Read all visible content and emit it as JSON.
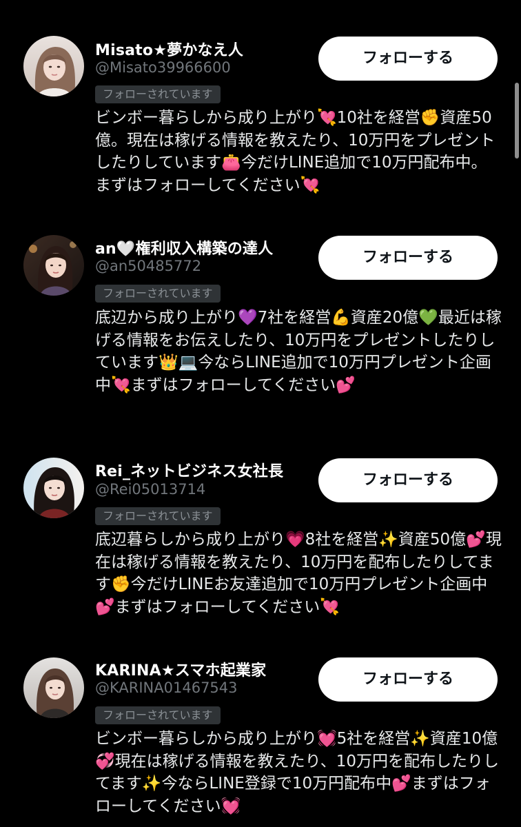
{
  "users": [
    {
      "display_name": "Misato★夢かなえ人",
      "handle": "@Misato39966600",
      "follows_you_label": "フォローされています",
      "follow_button_label": "フォローする",
      "bio": "ビンボー暮らしから成り上がり💘10社を経営✊資産50億。現在は稼げる情報を教えたり、10万円をプレゼントしたりしています👛今だけLINE追加で10万円配布中。まずはフォローしてください💘"
    },
    {
      "display_name": "an🤍権利収入構築の達人",
      "handle": "@an50485772",
      "follows_you_label": "フォローされています",
      "follow_button_label": "フォローする",
      "bio": "底辺から成り上がり💜7社を経営💪資産20億💚最近は稼げる情報をお伝えしたり、10万円をプレゼントしたりしています👑💻今ならLINE追加で10万円プレゼント企画中💘まずはフォローしてください💕"
    },
    {
      "display_name": "Rei_ネットビジネス女社長",
      "handle": "@Rei05013714",
      "follows_you_label": "フォローされています",
      "follow_button_label": "フォローする",
      "bio": "底辺暮らしから成り上がり💗8社を経営✨資産50億💕現在は稼げる情報を教えたり、10万円を配布したりしてます✊今だけLINEお友達追加で10万円プレゼント企画中💕まずはフォローしてください💘"
    },
    {
      "display_name": "KARINA★スマホ起業家",
      "handle": "@KARINA01467543",
      "follows_you_label": "フォローされています",
      "follow_button_label": "フォローする",
      "bio": "ビンボー暮らしから成り上がり💓5社を経営✨資産10億💞現在は稼げる情報を教えたり、10万円を配布したりしてます✨今ならLINE登録で10万円配布中💕まずはフォローしてください💓"
    }
  ],
  "colors": {
    "background": "#000000",
    "name_text": "#ffffff",
    "secondary_text": "#71767b",
    "badge_background": "#2f3336",
    "button_background": "#ffffff",
    "button_text": "#0f1419"
  }
}
